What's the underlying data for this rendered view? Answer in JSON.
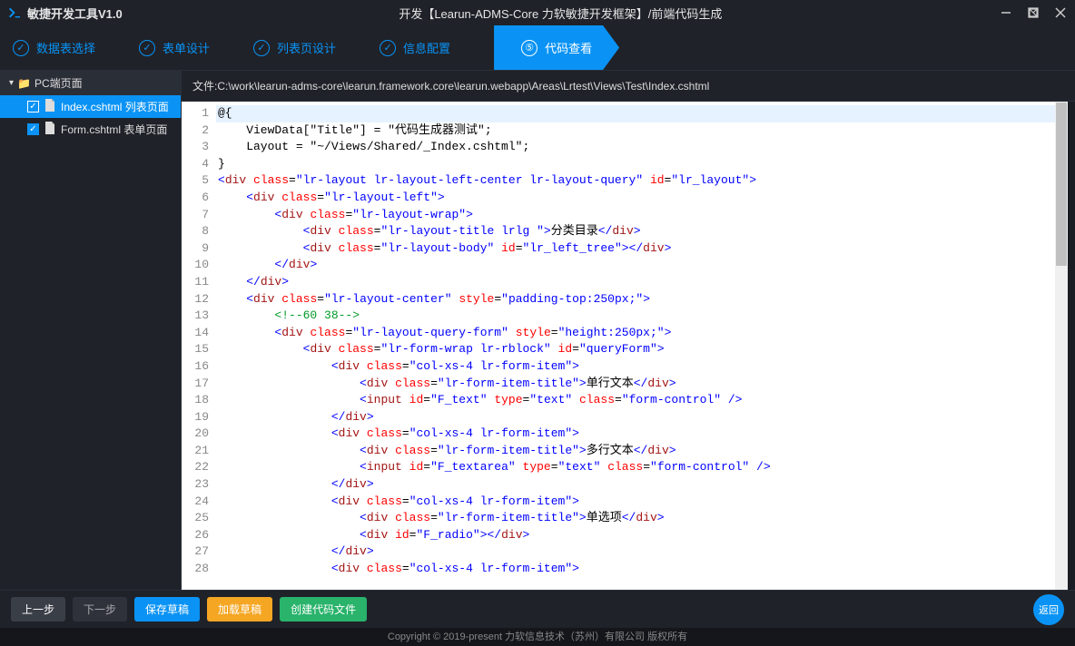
{
  "titlebar": {
    "app_title": "敏捷开发工具V1.0",
    "window_title": "开发【Learun-ADMS-Core 力软敏捷开发框架】/前端代码生成"
  },
  "steps": [
    {
      "label": "数据表选择",
      "check": true
    },
    {
      "label": "表单设计",
      "check": true
    },
    {
      "label": "列表页设计",
      "check": true
    },
    {
      "label": "信息配置",
      "check": true
    },
    {
      "num": "⑤",
      "label": "代码查看",
      "active": true
    }
  ],
  "sidebar": {
    "header": "PC端页面",
    "items": [
      {
        "label": "Index.cshtml 列表页面",
        "active": true
      },
      {
        "label": "Form.cshtml 表单页面",
        "active": false
      }
    ]
  },
  "pathbar": "文件:C:\\work\\learun-adms-core\\learun.framework.core\\learun.webapp\\Areas\\Lrtest\\Views\\Test\\Index.cshtml",
  "code_lines": [
    {
      "n": 1,
      "hl": true,
      "html": "@{"
    },
    {
      "n": 2,
      "html": "    ViewData[\"Title\"] = \"代码生成器测试\";"
    },
    {
      "n": 3,
      "html": "    Layout = \"~/Views/Shared/_Index.cshtml\";"
    },
    {
      "n": 4,
      "html": "}"
    },
    {
      "n": 5,
      "html": "<span class='t-punc'>&lt;</span><span class='t-tag'>div</span> <span class='t-attr'>class</span>=<span class='t-str'>\"lr-layout lr-layout-left-center lr-layout-query\"</span> <span class='t-attr'>id</span>=<span class='t-str'>\"lr_layout\"</span><span class='t-punc'>&gt;</span>"
    },
    {
      "n": 6,
      "html": "    <span class='t-punc'>&lt;</span><span class='t-tag'>div</span> <span class='t-attr'>class</span>=<span class='t-str'>\"lr-layout-left\"</span><span class='t-punc'>&gt;</span>"
    },
    {
      "n": 7,
      "html": "        <span class='t-punc'>&lt;</span><span class='t-tag'>div</span> <span class='t-attr'>class</span>=<span class='t-str'>\"lr-layout-wrap\"</span><span class='t-punc'>&gt;</span>"
    },
    {
      "n": 8,
      "html": "            <span class='t-punc'>&lt;</span><span class='t-tag'>div</span> <span class='t-attr'>class</span>=<span class='t-str'>\"lr-layout-title lrlg \"</span><span class='t-punc'>&gt;</span>分类目录<span class='t-punc'>&lt;/</span><span class='t-tag'>div</span><span class='t-punc'>&gt;</span>"
    },
    {
      "n": 9,
      "html": "            <span class='t-punc'>&lt;</span><span class='t-tag'>div</span> <span class='t-attr'>class</span>=<span class='t-str'>\"lr-layout-body\"</span> <span class='t-attr'>id</span>=<span class='t-str'>\"lr_left_tree\"</span><span class='t-punc'>&gt;&lt;/</span><span class='t-tag'>div</span><span class='t-punc'>&gt;</span>"
    },
    {
      "n": 10,
      "html": "        <span class='t-punc'>&lt;/</span><span class='t-tag'>div</span><span class='t-punc'>&gt;</span>"
    },
    {
      "n": 11,
      "html": "    <span class='t-punc'>&lt;/</span><span class='t-tag'>div</span><span class='t-punc'>&gt;</span>"
    },
    {
      "n": 12,
      "html": "    <span class='t-punc'>&lt;</span><span class='t-tag'>div</span> <span class='t-attr'>class</span>=<span class='t-str'>\"lr-layout-center\"</span> <span class='t-attr'>style</span>=<span class='t-str'>\"padding-top:250px;\"</span><span class='t-punc'>&gt;</span>"
    },
    {
      "n": 13,
      "html": "        <span class='t-cm'>&lt;!--60 38--&gt;</span>"
    },
    {
      "n": 14,
      "html": "        <span class='t-punc'>&lt;</span><span class='t-tag'>div</span> <span class='t-attr'>class</span>=<span class='t-str'>\"lr-layout-query-form\"</span> <span class='t-attr'>style</span>=<span class='t-str'>\"height:250px;\"</span><span class='t-punc'>&gt;</span>"
    },
    {
      "n": 15,
      "html": "            <span class='t-punc'>&lt;</span><span class='t-tag'>div</span> <span class='t-attr'>class</span>=<span class='t-str'>\"lr-form-wrap lr-rblock\"</span> <span class='t-attr'>id</span>=<span class='t-str'>\"queryForm\"</span><span class='t-punc'>&gt;</span>"
    },
    {
      "n": 16,
      "html": "                <span class='t-punc'>&lt;</span><span class='t-tag'>div</span> <span class='t-attr'>class</span>=<span class='t-str'>\"col-xs-4 lr-form-item\"</span><span class='t-punc'>&gt;</span>"
    },
    {
      "n": 17,
      "html": "                    <span class='t-punc'>&lt;</span><span class='t-tag'>div</span> <span class='t-attr'>class</span>=<span class='t-str'>\"lr-form-item-title\"</span><span class='t-punc'>&gt;</span>单行文本<span class='t-punc'>&lt;/</span><span class='t-tag'>div</span><span class='t-punc'>&gt;</span>"
    },
    {
      "n": 18,
      "html": "                    <span class='t-punc'>&lt;</span><span class='t-tag'>input</span> <span class='t-attr'>id</span>=<span class='t-str'>\"F_text\"</span> <span class='t-attr'>type</span>=<span class='t-str'>\"text\"</span> <span class='t-attr'>class</span>=<span class='t-str'>\"form-control\"</span> <span class='t-punc'>/&gt;</span>"
    },
    {
      "n": 19,
      "html": "                <span class='t-punc'>&lt;/</span><span class='t-tag'>div</span><span class='t-punc'>&gt;</span>"
    },
    {
      "n": 20,
      "html": "                <span class='t-punc'>&lt;</span><span class='t-tag'>div</span> <span class='t-attr'>class</span>=<span class='t-str'>\"col-xs-4 lr-form-item\"</span><span class='t-punc'>&gt;</span>"
    },
    {
      "n": 21,
      "html": "                    <span class='t-punc'>&lt;</span><span class='t-tag'>div</span> <span class='t-attr'>class</span>=<span class='t-str'>\"lr-form-item-title\"</span><span class='t-punc'>&gt;</span>多行文本<span class='t-punc'>&lt;/</span><span class='t-tag'>div</span><span class='t-punc'>&gt;</span>"
    },
    {
      "n": 22,
      "html": "                    <span class='t-punc'>&lt;</span><span class='t-tag'>input</span> <span class='t-attr'>id</span>=<span class='t-str'>\"F_textarea\"</span> <span class='t-attr'>type</span>=<span class='t-str'>\"text\"</span> <span class='t-attr'>class</span>=<span class='t-str'>\"form-control\"</span> <span class='t-punc'>/&gt;</span>"
    },
    {
      "n": 23,
      "html": "                <span class='t-punc'>&lt;/</span><span class='t-tag'>div</span><span class='t-punc'>&gt;</span>"
    },
    {
      "n": 24,
      "html": "                <span class='t-punc'>&lt;</span><span class='t-tag'>div</span> <span class='t-attr'>class</span>=<span class='t-str'>\"col-xs-4 lr-form-item\"</span><span class='t-punc'>&gt;</span>"
    },
    {
      "n": 25,
      "html": "                    <span class='t-punc'>&lt;</span><span class='t-tag'>div</span> <span class='t-attr'>class</span>=<span class='t-str'>\"lr-form-item-title\"</span><span class='t-punc'>&gt;</span>单选项<span class='t-punc'>&lt;/</span><span class='t-tag'>div</span><span class='t-punc'>&gt;</span>"
    },
    {
      "n": 26,
      "html": "                    <span class='t-punc'>&lt;</span><span class='t-tag'>div</span> <span class='t-attr'>id</span>=<span class='t-str'>\"F_radio\"</span><span class='t-punc'>&gt;&lt;/</span><span class='t-tag'>div</span><span class='t-punc'>&gt;</span>"
    },
    {
      "n": 27,
      "html": "                <span class='t-punc'>&lt;/</span><span class='t-tag'>div</span><span class='t-punc'>&gt;</span>"
    },
    {
      "n": 28,
      "html": "                <span class='t-punc'>&lt;</span><span class='t-tag'>div</span> <span class='t-attr'>class</span>=<span class='t-str'>\"col-xs-4 lr-form-item\"</span><span class='t-punc'>&gt;</span>"
    }
  ],
  "footer": {
    "prev": "上一步",
    "next": "下一步",
    "save_draft": "保存草稿",
    "load_draft": "加载草稿",
    "create_file": "创建代码文件",
    "return": "返回"
  },
  "copyright": "Copyright © 2019-present 力软信息技术（苏州）有限公司 版权所有"
}
